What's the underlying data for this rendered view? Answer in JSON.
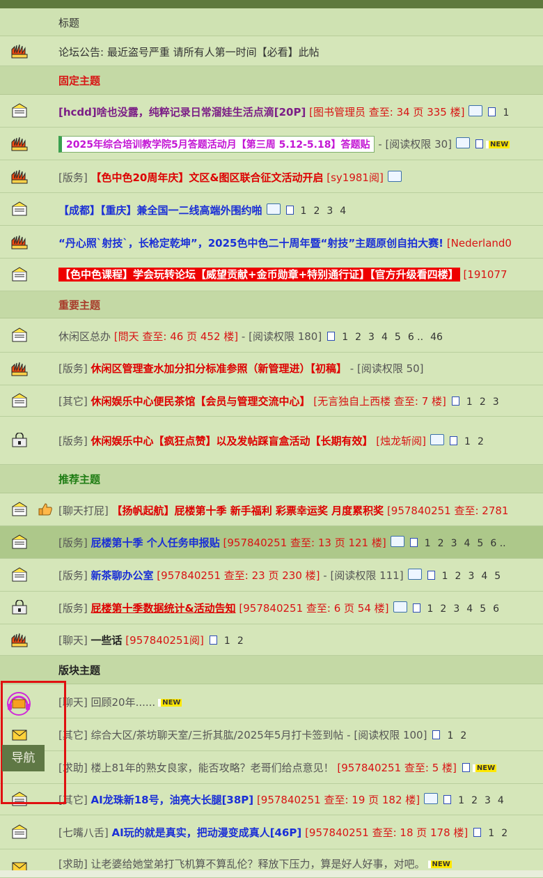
{
  "header": {
    "title": "标题"
  },
  "announcement": {
    "text": "论坛公告: 最近盗号严重 请所有人第一时间【必看】此帖"
  },
  "sections": {
    "fixed": "固定主题",
    "important": "重要主题",
    "recommended": "推荐主题",
    "board": "版块主题"
  },
  "colors": {
    "accent_red": "#d81414",
    "nav_border": "#e01010",
    "nav_bg": "#5f7845"
  },
  "threads": {
    "r1": {
      "title": "[hcdd]啥也没露，纯粹记录日常溜娃生活点滴[20P]",
      "author": "[图书管理员 查至: 34 页 335 楼]",
      "pages": [
        "1"
      ]
    },
    "r2": {
      "title": "2025年综合培训教学院5月答题活动月【第三周 5.12-5.18】答题贴",
      "meta": "- [阅读权限 30]",
      "badge": "NEW"
    },
    "r3": {
      "tag": "[版务]",
      "title": "【色中色20周年庆】文区&图区联合征文活动开启",
      "author": "[sy1981阅]"
    },
    "r4": {
      "title": "【成都】【重庆】兼全国一二线高端外围约啪",
      "pages": [
        "1",
        "2",
        "3",
        "4"
      ]
    },
    "r5": {
      "title": "“丹心照`射技`，长枪定乾坤”，2025色中色二十周年暨“射技”主题原创自拍大赛!",
      "author": "[Nederland0"
    },
    "r6": {
      "title": "【色中色课程】学会玩转论坛【威望贡献+金币勋章+特别通行证】【官方升级看四楼】",
      "author": "[191077"
    },
    "i1": {
      "prefix": "休闲区总办",
      "author": "[問天 查至: 46 页 452 楼]",
      "meta": "- [阅读权限 180]",
      "pages": [
        "1",
        "2",
        "3",
        "4",
        "5",
        "6 ..",
        "46"
      ]
    },
    "i2": {
      "tag": "[版务]",
      "title": "休闲区管理查水加分扣分标准参照（新管理进）【初稿】",
      "meta": "- [阅读权限 50]"
    },
    "i3": {
      "tag": "[其它]",
      "title": "休闲娱乐中心便民茶馆【会员与管理交流中心】",
      "author": "[无言独自上西楼 查至: 7 楼]",
      "pages": [
        "1",
        "2",
        "3"
      ]
    },
    "i4": {
      "tag": "[版务]",
      "title": "休闲娱乐中心【疯狂点赞】以及发帖踩盲盒活动【长期有效】",
      "author": "[烛龙斩阅]",
      "pages": [
        "1",
        "2"
      ]
    },
    "p1": {
      "tag": "[聊天打屁]",
      "title": "【扬帆起航】屁楼第十季  新手福利 彩票幸运奖  月度累积奖",
      "author": "[957840251 查至: 2781"
    },
    "p2": {
      "tag": "[版务]",
      "title": "屁楼第十季 个人任务申报贴",
      "author": "[957840251 查至: 13 页 121 楼]",
      "pages": [
        "1",
        "2",
        "3",
        "4",
        "5",
        "6 .."
      ]
    },
    "p3": {
      "tag": "[版务]",
      "title": "新茶聊办公室",
      "author": "[957840251 查至: 23 页 230 楼]",
      "meta": "- [阅读权限 111]",
      "pages": [
        "1",
        "2",
        "3",
        "4",
        "5"
      ]
    },
    "p4": {
      "tag": "[版务]",
      "title": "屁楼第十季数据统计&活动告知",
      "author": "[957840251 查至: 6 页 54 楼]",
      "pages": [
        "1",
        "2",
        "3",
        "4",
        "5",
        "6"
      ]
    },
    "p5": {
      "tag": "[聊天]",
      "title": "一些话",
      "author": "[957840251阅]",
      "pages": [
        "1",
        "2"
      ]
    },
    "b1": {
      "tag": "[聊天]",
      "title": "回顾20年......",
      "badge": "NEW"
    },
    "b2": {
      "tag": "[其它]",
      "title": "综合大区/茶坊聊天室/三折其肱/2025年5月打卡签到帖",
      "meta": "- [阅读权限 100]",
      "pages": [
        "1",
        "2"
      ]
    },
    "b3": {
      "tag": "[求助]",
      "title": "楼上81年的熟女良家，能否攻略？老哥们给点意见！",
      "author": "[957840251 查至: 5 楼]",
      "badge": "NEW"
    },
    "b4": {
      "tag": "[其它]",
      "title": "AI龙珠新18号，油亮大长腿[38P]",
      "author": "[957840251 查至: 19 页 182 楼]",
      "pages": [
        "1",
        "2",
        "3",
        "4"
      ]
    },
    "b5": {
      "tag": "[七嘴八舌]",
      "title": "AI玩的就是真实，把动漫变成真人[46P]",
      "author": "[957840251 查至: 18 页 178 楼]",
      "pages": [
        "1",
        "2"
      ]
    },
    "b6": {
      "tag": "[求助]",
      "title": "让老婆给她堂弟打飞机算不算乱伦？释放下压力，算是好人好事，对吧。",
      "badge": "NEW"
    }
  },
  "nav": {
    "label": "导航"
  }
}
